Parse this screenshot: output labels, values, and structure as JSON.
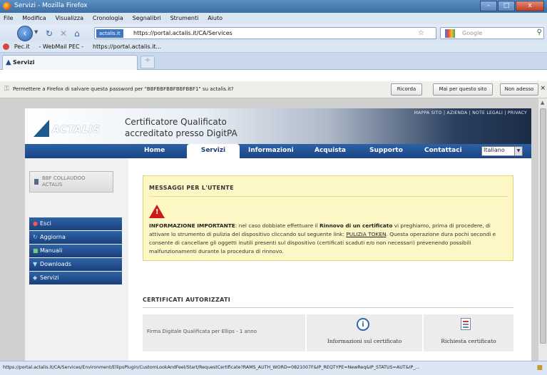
{
  "window": {
    "title": "Servizi - Mozilla Firefox",
    "buttons": [
      "–",
      "□",
      "x"
    ]
  },
  "menubar": [
    "File",
    "Modifica",
    "Visualizza",
    "Cronologia",
    "Segnalibri",
    "Strumenti",
    "Aiuto"
  ],
  "navbar": {
    "site_badge": "actalis.it",
    "url": "https://portal.actalis.it/CA/Services",
    "search_placeholder": "Google"
  },
  "bookmarks": [
    "Pec.it",
    "- WebMail PEC -",
    "https://portal.actalis.it..."
  ],
  "tab": {
    "label": "Servizi",
    "new_tab": "+"
  },
  "notification": {
    "message": "Permettere a Firefox di salvare questa password per \"BBFBBFBBFBBFBBF1\" su actalis.it?",
    "btn_remember": "Ricorda",
    "btn_never": "Mai per questo sito",
    "btn_notnow": "Non adesso"
  },
  "site": {
    "toplinks": "MAPPA SITO | AZIENDA | NOTE LEGALI | PRIVACY",
    "logo": "ACTALIS",
    "cert_line1": "Certificatore Qualificato",
    "cert_line2": "accreditato presso DigitPA",
    "nav": [
      "Home",
      "Servizi",
      "Informazioni",
      "Acquista",
      "Supporto",
      "Contattaci"
    ],
    "language": "Italiano",
    "user": [
      "BBF COLLAUDOO",
      "ACTALIS"
    ],
    "sidemenu": [
      {
        "label": "Esci",
        "icon": "exit-icon"
      },
      {
        "label": "Aggiorna",
        "icon": "refresh-icon"
      },
      {
        "label": "Manuali",
        "icon": "book-icon"
      },
      {
        "label": "Downloads",
        "icon": "download-icon"
      },
      {
        "label": "Servizi",
        "icon": "services-icon"
      }
    ],
    "messages": {
      "heading": "MESSAGGI PER L'UTENTE",
      "p1": "INFORMAZIONE IMPORTANTE",
      "p2": ": nel caso dobbiate effettuare il ",
      "p3": "Rinnovo di un certificato",
      "p4": " vi preghiamo, prima di procedere, di attivare lo strumento di pulizia del dispositivo cliccando sul seguente link: ",
      "link": "PULIZIA TOKEN",
      "p5": ". Questa operazione dura pochi secondi e consente di cancellare gli oggetti inutili presenti sul dispositivo (certificati scaduti e/o non necessari) prevenendo possibili malfunzionamenti durante la procedura di rinnovo."
    },
    "authorized": {
      "heading": "CERTIFICATI AUTORIZZATI",
      "row_label": "Firma Digitale Qualificata per Ellips - 1 anno",
      "info_btn": "Informazioni sul certificato",
      "request_btn": "Richiesta certificato"
    }
  },
  "statusbar": "https://portal.actalis.it/CA/Services/Environment/EllipsPlugin/CustomLookAndFeel/Start/RequestCertificate?RAMS_AUTH_WORD=0821007F&IP_REQTYPE=NewReq&IP_STATUS=AUT&IP_..."
}
